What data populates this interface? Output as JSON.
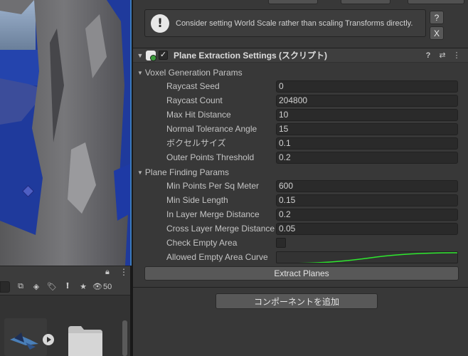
{
  "warning": {
    "message": "Consider setting World Scale rather than scaling Transforms directly.",
    "help_label": "?",
    "close_label": "X"
  },
  "component": {
    "title": "Plane Extraction Settings (スクリプト)",
    "enabled_mark": "✓",
    "help_icon": "?",
    "settings_icon": "⇄",
    "menu_icon": "⋮"
  },
  "groups": [
    {
      "title": "Voxel Generation Params",
      "props": [
        {
          "label": "Raycast Seed",
          "value": "0"
        },
        {
          "label": "Raycast Count",
          "value": "204800"
        },
        {
          "label": "Max Hit Distance",
          "value": "10"
        },
        {
          "label": "Normal Tolerance Angle",
          "value": "15"
        },
        {
          "label": "ボクセルサイズ",
          "value": "0.1"
        },
        {
          "label": "Outer Points Threshold",
          "value": "0.2"
        }
      ]
    },
    {
      "title": "Plane Finding Params",
      "props": [
        {
          "label": "Min Points Per Sq Meter",
          "value": "600"
        },
        {
          "label": "Min Side Length",
          "value": "0.15"
        },
        {
          "label": "In Layer Merge Distance",
          "value": "0.2"
        },
        {
          "label": "Cross Layer Merge Distance",
          "value": "0.05"
        },
        {
          "label": "Check Empty Area",
          "value": false
        },
        {
          "label": "Allowed Empty Area Curve",
          "value": "curve"
        }
      ]
    }
  ],
  "buttons": {
    "extract": "Extract Planes",
    "add_component": "コンポーネントを追加"
  },
  "project_toolbar": {
    "hidden_count": "50"
  },
  "colors": {
    "curve": "#2ee82e",
    "accent": "#3a79bb"
  }
}
